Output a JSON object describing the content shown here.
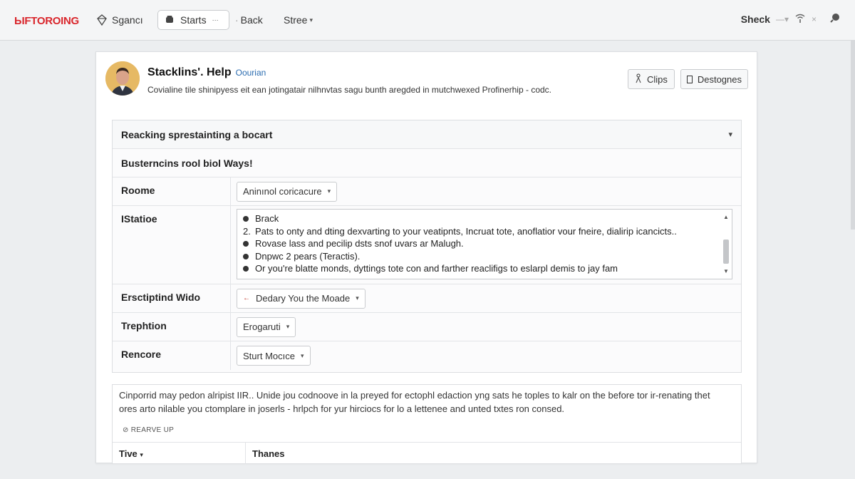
{
  "topbar": {
    "brand": "ЫFTOROING",
    "search_label": "Sgancı",
    "starts_label": "Starts",
    "starts_badge": "···",
    "back_label": "Back",
    "stree_label": "Stree",
    "user_label": "Sheck"
  },
  "profile": {
    "title": "Stacklins'. Help",
    "link": "Oourian",
    "description": "Covialine tile shinipyess eit ean jotingatair nilhnvtas sagu bunth aregded in mutchwexed Profinerhip - codc.",
    "clips_label": "Clips",
    "destognes_label": "Destognes"
  },
  "panel": {
    "header": "Reacking sprestainting a bocart",
    "subheader": "Busterncins rool biol Ways!",
    "rows": {
      "rome": {
        "label": "Roome",
        "value": "Aninınol coricacure"
      },
      "station": {
        "label": "IStatioe",
        "items": [
          {
            "marker": "dot",
            "text": "Brack"
          },
          {
            "marker": "2.",
            "text": "Pats to onty and dting dexvarting to your veatipnts, Incruat tote, anoflatior vour fneire, dialirip icancicts.."
          },
          {
            "marker": "dot",
            "text": "Rovase lass and pecilip dsts snof uvars ar Malugh."
          },
          {
            "marker": "dot",
            "text": "Dnpwc 2 pears (Teractis)."
          },
          {
            "marker": "dot",
            "text": "Or you're blatte monds, dyttings tote con and farther reaclifigs to eslarpl demis to jay fam"
          }
        ]
      },
      "ersc": {
        "label": "Ersctiptind Wido",
        "value": "Dedary You the Moade"
      },
      "trephtion": {
        "label": "Trephtion",
        "value": "Erogaruti"
      },
      "rencore": {
        "label": "Rencore",
        "value": "Sturt Mocıce"
      }
    }
  },
  "notes": {
    "line1": "Cinporrid may pedon alripist IIR.. Unide jou codnoove in la preyed for ectophl edaction yng sats he toples to kalr on the before tor ir-renating thet",
    "line2": "ores arto nilable you ctomplare in joserls - hrlpch for yur hirciocs for lo a lettenee and unted txtes ron consed.",
    "meta": "REARVE UP",
    "col1": "Tive",
    "col2": "Thanes"
  }
}
